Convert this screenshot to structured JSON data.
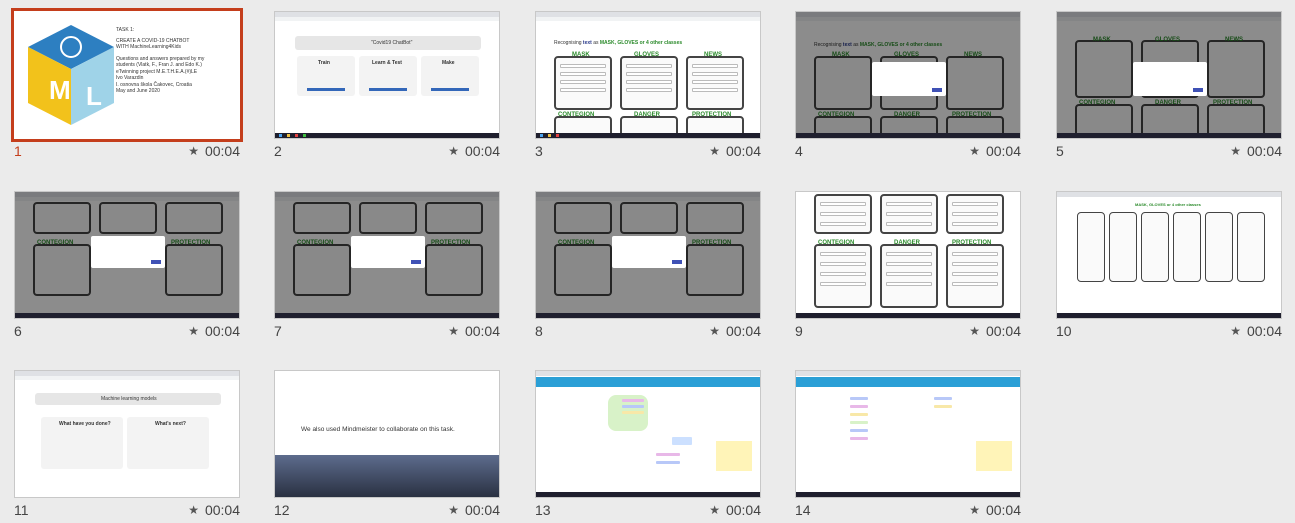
{
  "slides": [
    {
      "number": "1",
      "duration": "00:04",
      "selected": true,
      "content": {
        "title": "TASK 1:",
        "subtitle_line1": "CREATE A COVID-19 CHATBOT",
        "subtitle_line2": "WITH MachineLearning4Kids",
        "bullets": [
          "Questions and answers prepared by my",
          "students (Vlatk, F., Fran J. and Edo K.)",
          "eTwinning project M.E.T.H.E.A.(#)LE",
          "Ivo Varazdin",
          "I. osnovna škola Čakovec, Croatia",
          "May and June 2020"
        ],
        "logo_letters": [
          "M",
          "L"
        ]
      }
    },
    {
      "number": "2",
      "duration": "00:04",
      "content": {
        "banner": "\"Covid19 ChatBot\"",
        "panels": [
          "Train",
          "Learn & Test",
          "Make"
        ]
      }
    },
    {
      "number": "3",
      "duration": "00:04",
      "content": {
        "headline_pre": "Recognising",
        "headline_text": "text",
        "headline_as": "as",
        "headline_classes": "MASK, GLOVES or 4 other classes",
        "cols_top": [
          "MASK",
          "GLOVES",
          "NEWS"
        ],
        "cols_bottom": [
          "CONTEGION",
          "DANGER",
          "PROTECTION"
        ]
      }
    },
    {
      "number": "4",
      "duration": "00:04",
      "content": {
        "headline_pre": "Recognising",
        "headline_text": "text",
        "headline_as": "as",
        "headline_classes": "MASK, GLOVES or 4 other classes",
        "cols_top": [
          "MASK",
          "GLOVES",
          "NEWS"
        ],
        "cols_bottom": [
          "CONTEGION",
          "DANGER",
          "PROTECTION"
        ]
      }
    },
    {
      "number": "5",
      "duration": "00:04",
      "content": {
        "cols_top": [
          "MASK",
          "GLOVES",
          "NEWS"
        ],
        "cols_bottom": [
          "CONTEGION",
          "DANGER",
          "PROTECTION"
        ]
      }
    },
    {
      "number": "6",
      "duration": "00:04",
      "content": {
        "cols_bottom": [
          "CONTEGION",
          "PROTECTION"
        ]
      }
    },
    {
      "number": "7",
      "duration": "00:04",
      "content": {
        "cols_bottom": [
          "CONTEGION",
          "PROTECTION"
        ]
      }
    },
    {
      "number": "8",
      "duration": "00:04",
      "content": {
        "cols_bottom": [
          "CONTEGION",
          "PROTECTION"
        ]
      }
    },
    {
      "number": "9",
      "duration": "00:04",
      "content": {
        "cols_bottom": [
          "CONTEGION",
          "DANGER",
          "PROTECTION"
        ]
      }
    },
    {
      "number": "10",
      "duration": "00:04",
      "content": {
        "headline_classes": "MASK, GLOVES or 4 other classes"
      }
    },
    {
      "number": "11",
      "duration": "00:04",
      "content": {
        "banner": "Machine learning models",
        "left_title": "What have you done?",
        "right_title": "What's next?"
      }
    },
    {
      "number": "12",
      "duration": "00:04",
      "content": {
        "caption": "We also used Mindmeister to collaborate on this task."
      }
    },
    {
      "number": "13",
      "duration": "00:04",
      "content": {}
    },
    {
      "number": "14",
      "duration": "00:04",
      "content": {}
    }
  ],
  "colors": {
    "selected_border": "#c43e1c",
    "class_green": "#2a8a2a",
    "button_blue": "#3367b9"
  },
  "icons": {
    "duration": "star-icon"
  }
}
